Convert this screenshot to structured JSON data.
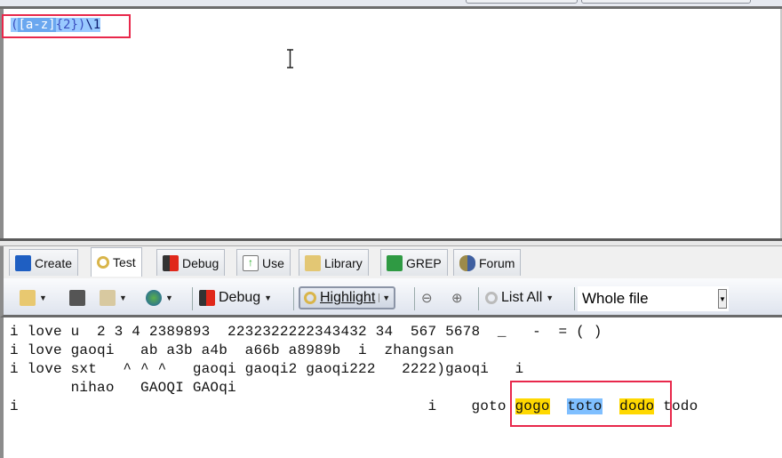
{
  "regex": {
    "parts": [
      "(",
      "[a-z]",
      "{2}",
      ")",
      "\\1"
    ]
  },
  "tabs": [
    {
      "label": "Create",
      "icon": "create-icon"
    },
    {
      "label": "Test",
      "icon": "test-icon"
    },
    {
      "label": "Debug",
      "icon": "debug-icon"
    },
    {
      "label": "Use",
      "icon": "use-icon"
    },
    {
      "label": "Library",
      "icon": "library-icon"
    },
    {
      "label": "GREP",
      "icon": "grep-icon"
    },
    {
      "label": "Forum",
      "icon": "forum-icon"
    }
  ],
  "toolbar": {
    "debug_label": "Debug",
    "highlight_label": "Highlight",
    "list_all_label": "List All",
    "scope_value": "Whole file"
  },
  "test_text": {
    "lines": [
      "i love u  2 3 4 2389893  2232322222343432 34  567 5678  _   -  = ( )",
      "i love gaoqi   ab a3b a4b  a66b a8989b  i  zhangsan",
      "i love sxt   ^ ^ ^   gaoqi gaoqi2 gaoqi222   2222)gaoqi   i",
      "       nihao   GAOQI GAOqi"
    ],
    "last_line": {
      "prefix": "i                                               i    goto ",
      "match1": "gogo",
      "gap1": "  ",
      "match2": "toto",
      "gap2": "  ",
      "match3": "dodo",
      "suffix": " todo"
    }
  },
  "colors": {
    "highlight_yellow": "#ffd800",
    "highlight_blue": "#7fbfff",
    "annotation_red": "#e8284b"
  }
}
